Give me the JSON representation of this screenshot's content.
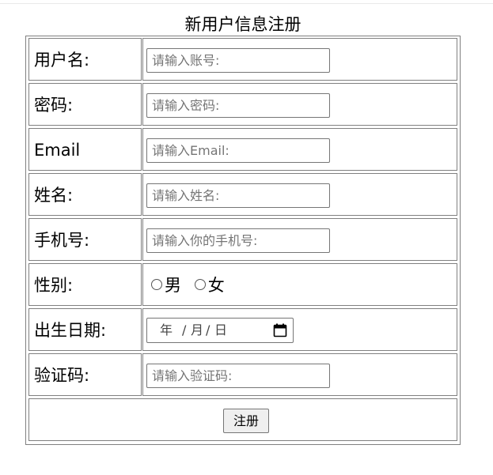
{
  "form": {
    "title": "新用户信息注册",
    "fields": [
      {
        "label": "用户名:",
        "placeholder": "请输入账号:"
      },
      {
        "label": "密码:",
        "placeholder": "请输入密码:"
      },
      {
        "label": "Email",
        "placeholder": "请输入Email:"
      },
      {
        "label": "姓名:",
        "placeholder": "请输入姓名:"
      },
      {
        "label": "手机号:",
        "placeholder": "请输入你的手机号:"
      }
    ],
    "gender": {
      "label": "性别:",
      "options": [
        "男",
        "女"
      ]
    },
    "birthdate": {
      "label": "出生日期:",
      "year": "年",
      "month": "月",
      "day": "日",
      "separator": "/"
    },
    "captcha": {
      "label": "验证码:",
      "placeholder": "请输入验证码:"
    },
    "submit_label": "注册"
  },
  "colors": {
    "border": "#808080",
    "input_border": "#767676",
    "placeholder": "#757575",
    "button_bg": "#efefef"
  },
  "icons": {
    "calendar": "calendar-icon",
    "radio": "radio-unchecked-icon"
  }
}
